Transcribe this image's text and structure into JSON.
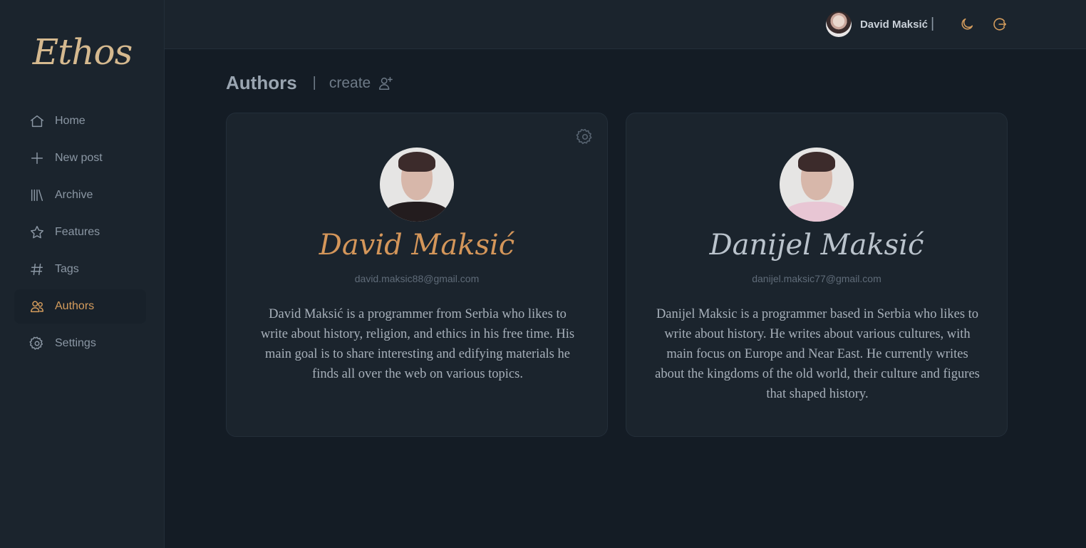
{
  "app": {
    "logo": "Ethos"
  },
  "sidebar": {
    "items": [
      {
        "label": "Home",
        "icon": "home-icon"
      },
      {
        "label": "New post",
        "icon": "plus-icon"
      },
      {
        "label": "Archive",
        "icon": "archive-icon"
      },
      {
        "label": "Features",
        "icon": "star-icon"
      },
      {
        "label": "Tags",
        "icon": "hash-icon"
      },
      {
        "label": "Authors",
        "icon": "users-icon",
        "active": true
      },
      {
        "label": "Settings",
        "icon": "gear-icon"
      }
    ]
  },
  "topbar": {
    "user_name": "David Maksić",
    "separator": "|",
    "theme_icon": "moon-icon",
    "logout_icon": "logout-icon"
  },
  "page": {
    "title": "Authors",
    "separator": "|",
    "create_label": "create",
    "create_icon": "user-plus-icon"
  },
  "authors": [
    {
      "name": "David Maksić",
      "email": "david.maksic88@gmail.com",
      "bio": "David Maksić is a programmer from Serbia who likes to write about history, religion, and ethics in his free time. His main goal is to share interesting and edifying materials he finds all over the web on various topics.",
      "settings_icon": "gear-icon"
    },
    {
      "name": "Danijel Maksić",
      "email": "danijel.maksic77@gmail.com",
      "bio": "Danijel Maksic is a programmer based in Serbia who likes to write about history. He writes about various cultures, with main focus on Europe and Near East. He currently writes about the kingdoms of the old world, their culture and figures that shaped history."
    }
  ],
  "colors": {
    "accent": "#d59d5d",
    "background": "#141c25",
    "panel": "#1b242d"
  }
}
